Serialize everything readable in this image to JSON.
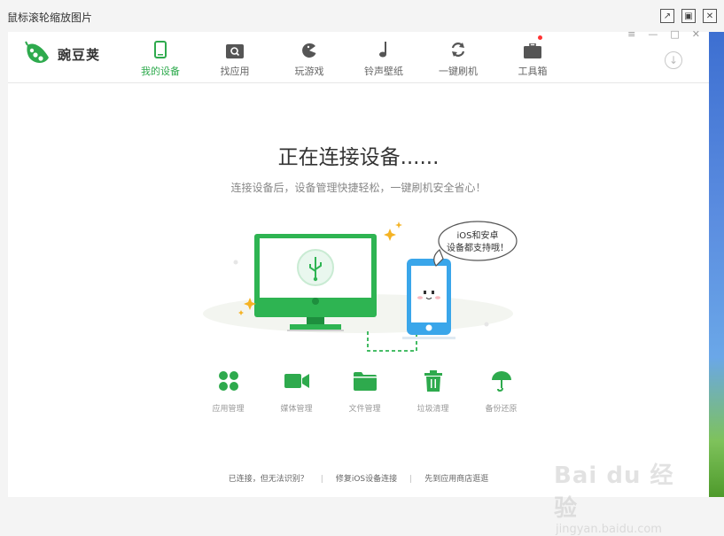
{
  "viewer": {
    "title": "鼠标滚轮缩放图片"
  },
  "app": {
    "logo_text": "豌豆荚",
    "nav": [
      {
        "label": "我的设备",
        "icon": "phone-icon",
        "active": true
      },
      {
        "label": "找应用",
        "icon": "search-icon",
        "active": false
      },
      {
        "label": "玩游戏",
        "icon": "game-icon",
        "active": false
      },
      {
        "label": "铃声壁纸",
        "icon": "music-note-icon",
        "active": false
      },
      {
        "label": "一键刷机",
        "icon": "refresh-icon",
        "active": false
      },
      {
        "label": "工具箱",
        "icon": "toolbox-icon",
        "active": false
      }
    ],
    "heading": "正在连接设备......",
    "subheading": "连接设备后，设备管理快捷轻松，一键刷机安全省心！",
    "bubble_line1": "iOS和安卓",
    "bubble_line2": "设备都支持哦！",
    "features": [
      {
        "label": "应用管理",
        "icon": "apps-grid-icon"
      },
      {
        "label": "媒体管理",
        "icon": "video-camera-icon"
      },
      {
        "label": "文件管理",
        "icon": "folder-icon"
      },
      {
        "label": "垃圾清理",
        "icon": "trash-icon"
      },
      {
        "label": "备份还原",
        "icon": "umbrella-icon"
      }
    ],
    "footer": {
      "link1": "已连接，但无法识别？",
      "link2": "修复iOS设备连接",
      "link3": "先到应用商店逛逛"
    }
  },
  "watermark": {
    "brand": "Bai du 经验",
    "url": "jingyan.baidu.com"
  },
  "colors": {
    "accent": "#2eaa4d",
    "phone_blue": "#3aa6ea",
    "star": "#f5b324"
  }
}
